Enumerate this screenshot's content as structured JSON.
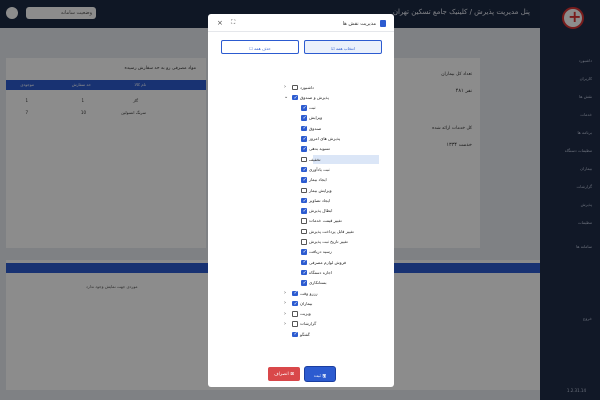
{
  "app": {
    "title": "پنل مدیریت پذیرش / کلینیک جامع تسکین تهران",
    "search_placeholder": "جستجو...",
    "search_value": "وضعیت سامانه"
  },
  "sidebar": {
    "items": [
      "داشبورد",
      "کاربران",
      "نقش ها",
      "خدمات",
      "برنامه ها",
      "تنظیمات دستگاه",
      "بیماران",
      "گزارشات",
      "پذیرش",
      "تنظیمات",
      "سامانه ها",
      "خروج"
    ],
    "version": "1.2.31.14"
  },
  "dashboard": {
    "patients_total_label": "تعداد کل بیماران",
    "patients_total_value": "۴۸۱ نفر",
    "services_total_label": "کل خدمات ارائه شده",
    "services_total_value": "۱۳۳۴ خدمت",
    "consumables_title": "مواد مصرفی رو به حد سفارش رسیده",
    "consumables_columns": [
      "نام کالا",
      "حد سفارش",
      "موجودی"
    ],
    "consumables_rows": [
      [
        "گاز",
        "1",
        "1"
      ],
      [
        "سرنگ انسولین",
        "10",
        "7"
      ]
    ],
    "bottom_table_note": "موردی جهت نمایش وجود ندارد"
  },
  "modal": {
    "title": "مدیریت نقش ها",
    "select_all_label": "انتخاب همه",
    "deselect_all_label": "حذف همه",
    "tree": [
      {
        "label": "داشبورد",
        "level": 0,
        "checked": false,
        "expander": "›"
      },
      {
        "label": "پذیرش و صندوق",
        "level": 0,
        "checked": true,
        "expander": "⌄"
      },
      {
        "label": "ثبت",
        "level": 1,
        "checked": true
      },
      {
        "label": "ویرایش",
        "level": 1,
        "checked": true
      },
      {
        "label": "صندوق",
        "level": 1,
        "checked": true
      },
      {
        "label": "پذیرش های امروز",
        "level": 1,
        "checked": true
      },
      {
        "label": "تسویه بدهی",
        "level": 1,
        "checked": true
      },
      {
        "label": "تخفیف",
        "level": 1,
        "checked": false,
        "highlight": true
      },
      {
        "label": "ثبت یادآوری",
        "level": 1,
        "checked": true
      },
      {
        "label": "ایجاد بیمار",
        "level": 1,
        "checked": true
      },
      {
        "label": "ویرایش بیمار",
        "level": 1,
        "checked": false
      },
      {
        "label": "ایجاد تصاویر",
        "level": 1,
        "checked": true
      },
      {
        "label": "ابطال پذیرش",
        "level": 1,
        "checked": true
      },
      {
        "label": "تغییر قیمت خدمات",
        "level": 1,
        "checked": false
      },
      {
        "label": "تغییر قابل پرداخت پذیرش",
        "level": 1,
        "checked": false
      },
      {
        "label": "تغییر تاریخ ثبت پذیرش",
        "level": 1,
        "checked": false
      },
      {
        "label": "رسید دریافت",
        "level": 1,
        "checked": true
      },
      {
        "label": "فروش لوازم مصرفی",
        "level": 1,
        "checked": true
      },
      {
        "label": "اجاره دستگاه",
        "level": 1,
        "checked": true
      },
      {
        "label": "بستانکاری",
        "level": 1,
        "checked": true
      },
      {
        "label": "رزرو وقت",
        "level": 0,
        "checked": true,
        "expander": "›"
      },
      {
        "label": "بیماران",
        "level": 0,
        "checked": true,
        "expander": "›"
      },
      {
        "label": "ویزیت",
        "level": 0,
        "checked": false,
        "expander": "›"
      },
      {
        "label": "گزارشات",
        "level": 0,
        "checked": false,
        "expander": "›"
      },
      {
        "label": "گفتگو",
        "level": 0,
        "checked": true
      }
    ],
    "save_label": "ثبت",
    "cancel_label": "انصراف"
  },
  "colors": {
    "primary": "#2c5bd0",
    "danger": "#d9484a",
    "sidebar": "#1f2d48"
  }
}
